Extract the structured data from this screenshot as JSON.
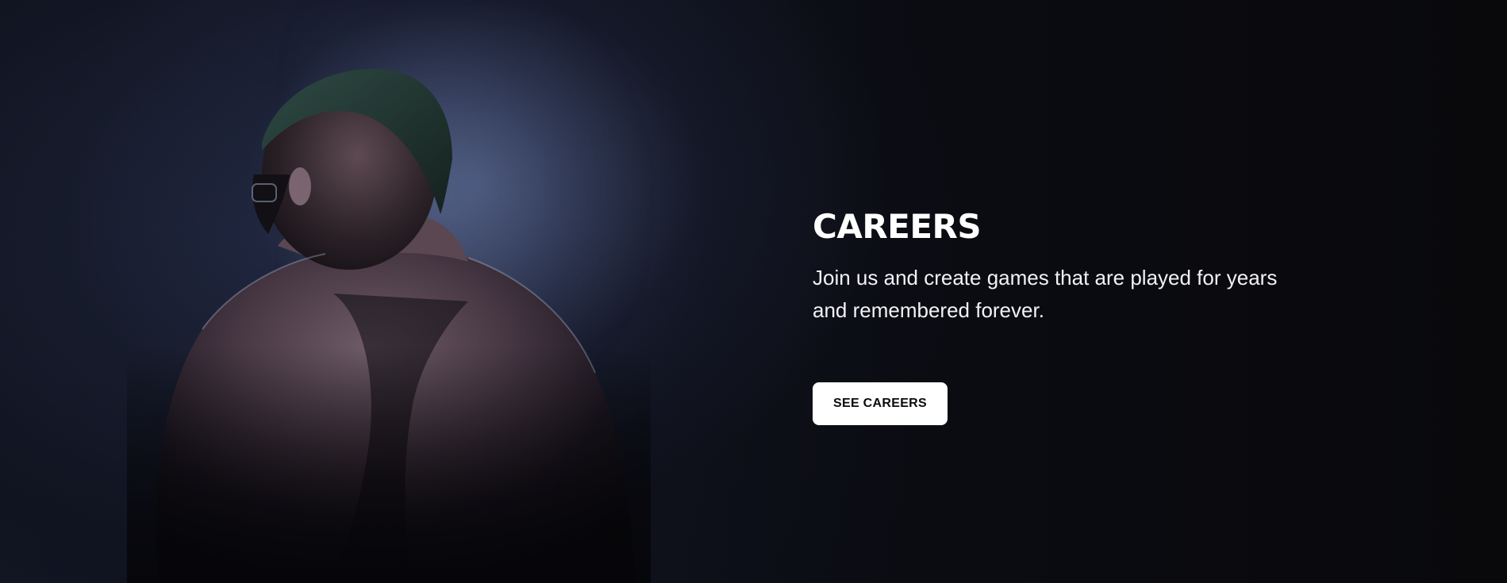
{
  "hero": {
    "background_image": "boxer-character-back-view",
    "title": "CAREERS",
    "subtitle": "Join us and create games that are played for years and remembered forever.",
    "cta_label": "SEE CAREERS"
  },
  "colors": {
    "background": "#09090c",
    "text": "#ffffff",
    "button_bg": "#ffffff",
    "button_text": "#0b0b0e"
  }
}
